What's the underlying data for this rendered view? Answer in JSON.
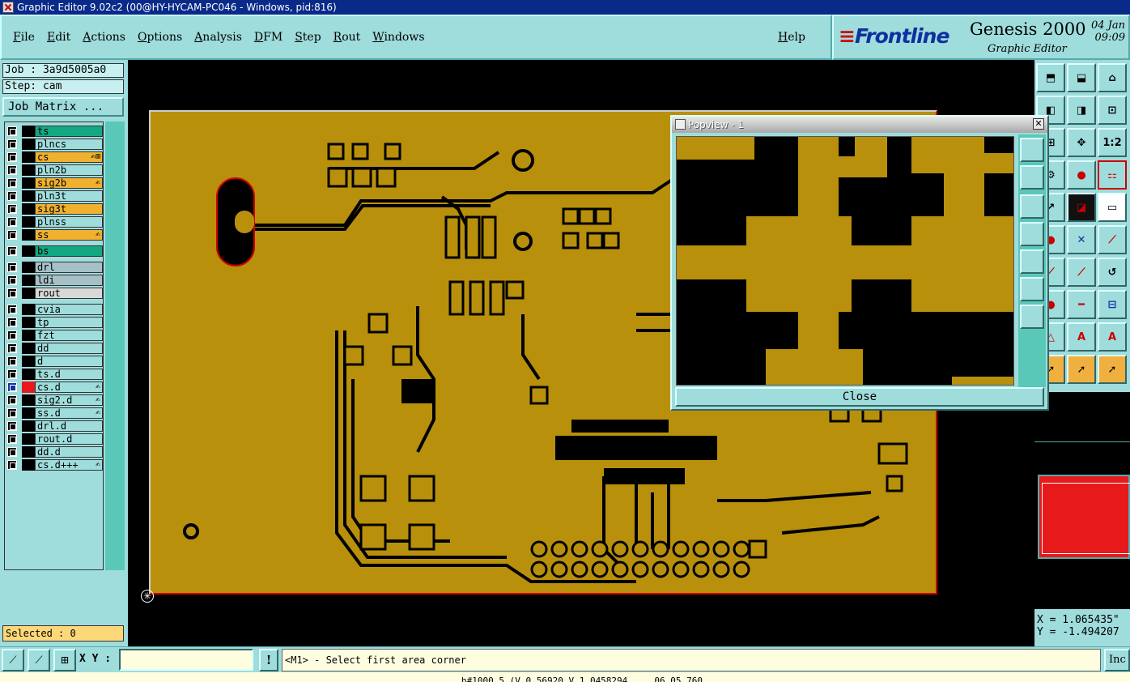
{
  "window": {
    "title": "Graphic Editor 9.02c2 (00@HY-HYCAM-PC046 - Windows, pid:816)"
  },
  "menu": {
    "items": [
      "File",
      "Edit",
      "Actions",
      "Options",
      "Analysis",
      "DFM",
      "Step",
      "Rout",
      "Windows"
    ],
    "help": "Help"
  },
  "brand": {
    "logo": "Frontline",
    "product": "Genesis 2000",
    "subtitle": "Graphic Editor",
    "date": "04 Jan",
    "time": "09:09"
  },
  "left": {
    "job": "Job : 3a9d5005a0",
    "step": "Step: cam",
    "job_matrix": "Job Matrix ...",
    "selected": "Selected : 0",
    "layers": [
      {
        "name": "ts",
        "bg": "#13a882",
        "flag": ""
      },
      {
        "name": "plncs",
        "bg": "#9fdcdc",
        "flag": ""
      },
      {
        "name": "cs",
        "bg": "#f0b030",
        "flag": "✍⊞"
      },
      {
        "name": "pln2b",
        "bg": "#9fdcdc",
        "flag": ""
      },
      {
        "name": "sig2b",
        "bg": "#f0b030",
        "flag": "✍"
      },
      {
        "name": "pln3t",
        "bg": "#9fdcdc",
        "flag": ""
      },
      {
        "name": "sig3t",
        "bg": "#f0b030",
        "flag": ""
      },
      {
        "name": "plnss",
        "bg": "#9fdcdc",
        "flag": ""
      },
      {
        "name": "ss",
        "bg": "#f0b030",
        "flag": "✍"
      },
      {
        "name": "bs",
        "bg": "#13a882",
        "flag": ""
      },
      {
        "name": "drl",
        "bg": "#a6c0c8",
        "flag": ""
      },
      {
        "name": "ldi",
        "bg": "#a6c0c8",
        "flag": ""
      },
      {
        "name": "rout",
        "bg": "#d8d8d8",
        "flag": ""
      },
      {
        "name": "cvia",
        "bg": "#9fdcdc",
        "flag": ""
      },
      {
        "name": "tp",
        "bg": "#9fdcdc",
        "flag": ""
      },
      {
        "name": "fzt",
        "bg": "#9fdcdc",
        "flag": ""
      },
      {
        "name": "dd",
        "bg": "#9fdcdc",
        "flag": ""
      },
      {
        "name": "d",
        "bg": "#9fdcdc",
        "flag": ""
      },
      {
        "name": "ts.d",
        "bg": "#9fdcdc",
        "flag": ""
      },
      {
        "name": "cs.d",
        "bg": "#9fdcdc",
        "flag": "✍"
      },
      {
        "name": "sig2.d",
        "bg": "#9fdcdc",
        "flag": "✍"
      },
      {
        "name": "ss.d",
        "bg": "#9fdcdc",
        "flag": "✍"
      },
      {
        "name": "drl.d",
        "bg": "#9fdcdc",
        "flag": ""
      },
      {
        "name": "rout.d",
        "bg": "#9fdcdc",
        "flag": ""
      },
      {
        "name": "dd.d",
        "bg": "#9fdcdc",
        "flag": ""
      },
      {
        "name": "cs.d+++",
        "bg": "#9fdcdc",
        "flag": "✍"
      }
    ]
  },
  "popview": {
    "title": "Popview - 1",
    "close": "Close"
  },
  "coords": {
    "x": "X = 1.065435\"",
    "y": "Y = -1.494207"
  },
  "status": {
    "xy_label": "X Y :",
    "prompt": "<M1> - Select first area corner",
    "inc": "Inc",
    "bottom": "h#1000 5 (V 0.56920 V 1.0458294 ... 06.05.760"
  },
  "toolbar": {
    "ratio_label": "1:2"
  }
}
